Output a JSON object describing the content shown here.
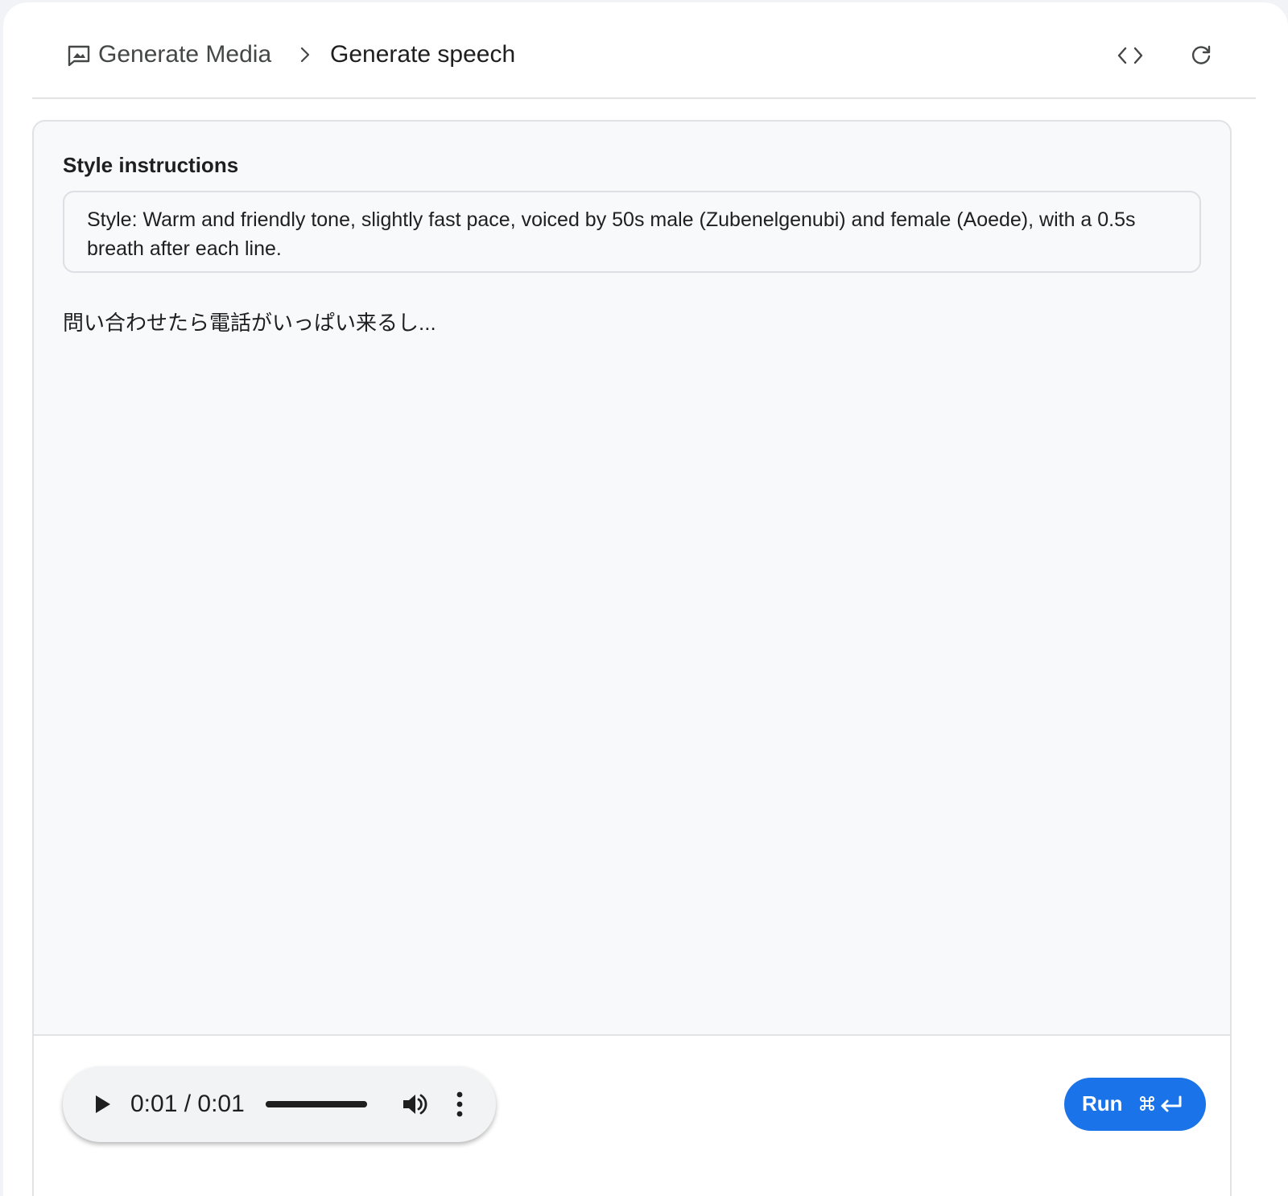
{
  "header": {
    "parent_label": "Generate Media",
    "current_label": "Generate speech",
    "icons": {
      "parent": "image-frame-icon",
      "separator": "chevron-right-icon",
      "code": "code-brackets-icon",
      "refresh": "refresh-icon"
    }
  },
  "style": {
    "label": "Style instructions",
    "value": "Style: Warm and friendly tone, slightly fast pace, voiced by 50s male (Zubenelgenubi) and female (Aoede), with a 0.5s breath after each line."
  },
  "prompt": {
    "text": "問い合わせたら電話がいっぱい来るし..."
  },
  "audio": {
    "time": "0:01 / 0:01",
    "progress": 1.0,
    "icons": {
      "play": "play-icon",
      "volume": "volume-icon",
      "more": "more-vert-icon"
    }
  },
  "run": {
    "label": "Run",
    "shortcut_icon": "cmd-enter-icon",
    "color": "#1a73e8"
  },
  "colors": {
    "panel_bg": "#f8f9fb",
    "text": "#1f1f1f",
    "accent": "#1a73e8"
  }
}
